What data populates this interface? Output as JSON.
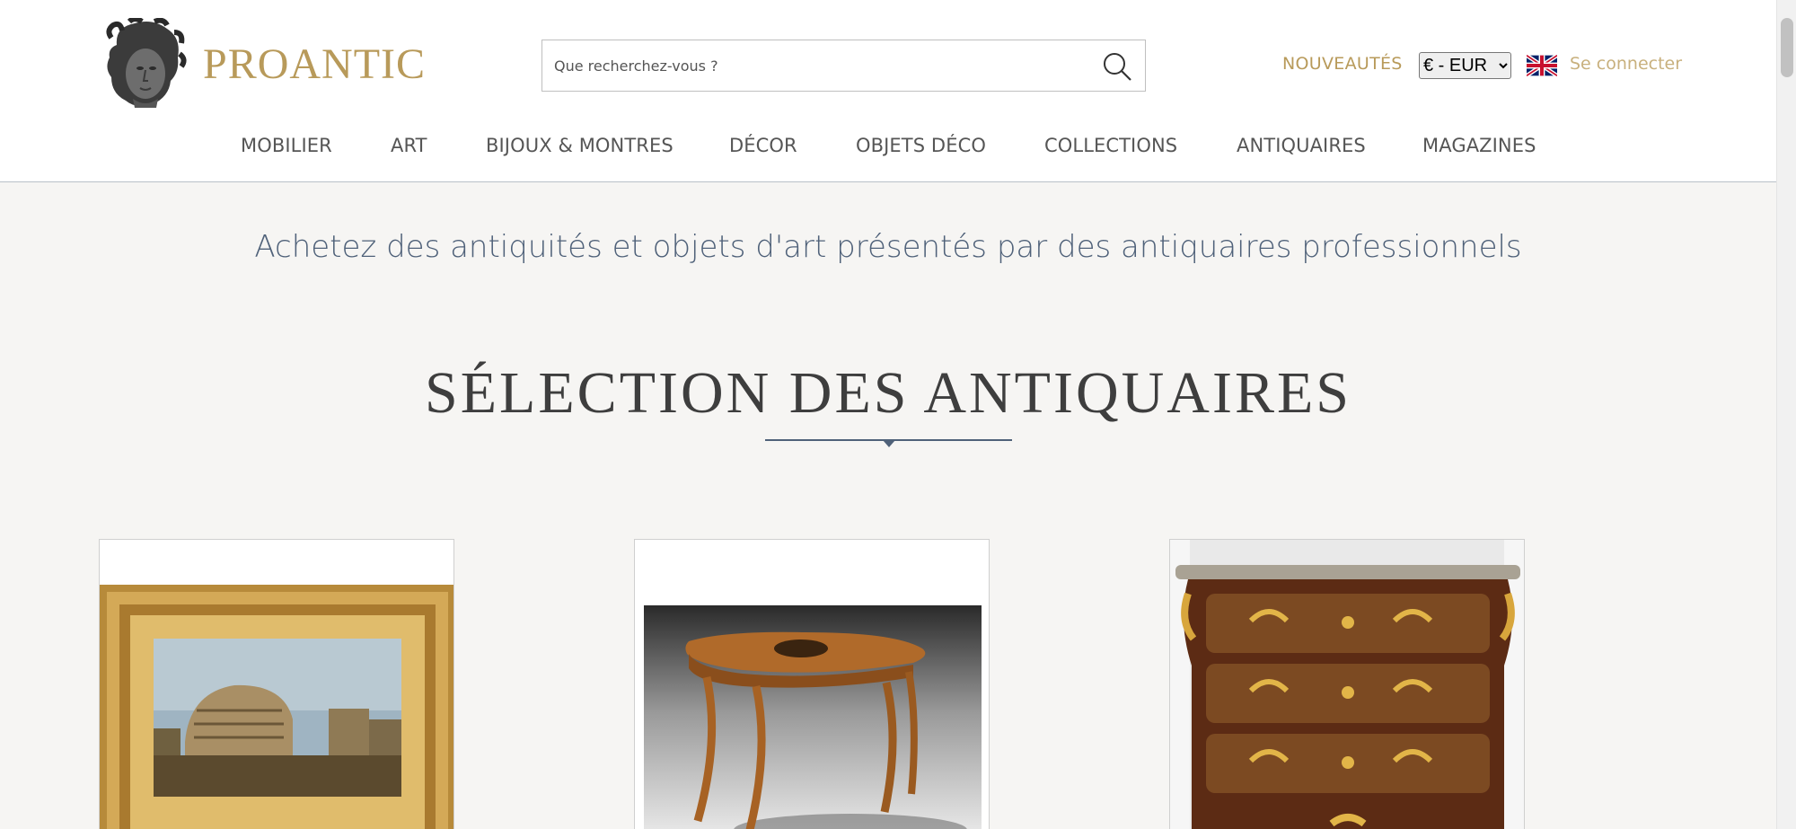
{
  "header": {
    "brand": "PROANTIC",
    "search_placeholder": "Que recherchez-vous ?",
    "news_label": "NOUVEAUTÉS",
    "currency_selected": "€ - EUR",
    "login_label": "Se connecter",
    "language_flag": "uk-flag-icon"
  },
  "nav": {
    "items": [
      "MOBILIER",
      "ART",
      "BIJOUX & MONTRES",
      "DÉCOR",
      "OBJETS DÉCO",
      "COLLECTIONS",
      "ANTIQUAIRES",
      "MAGAZINES"
    ]
  },
  "main": {
    "tagline": "Achetez des antiquités et objets d'art présentés par des antiquaires professionnels",
    "section_title": "SÉLECTION DES ANTIQUAIRES",
    "cards": [
      {
        "image": "colosseum-painting-gilt-frame"
      },
      {
        "image": "inlaid-walnut-side-table"
      },
      {
        "image": "marquetry-commode-marble-top"
      }
    ]
  },
  "colors": {
    "brand_gold": "#b89a5a",
    "accent_blue": "#4f6179",
    "background": "#f6f5f3"
  }
}
